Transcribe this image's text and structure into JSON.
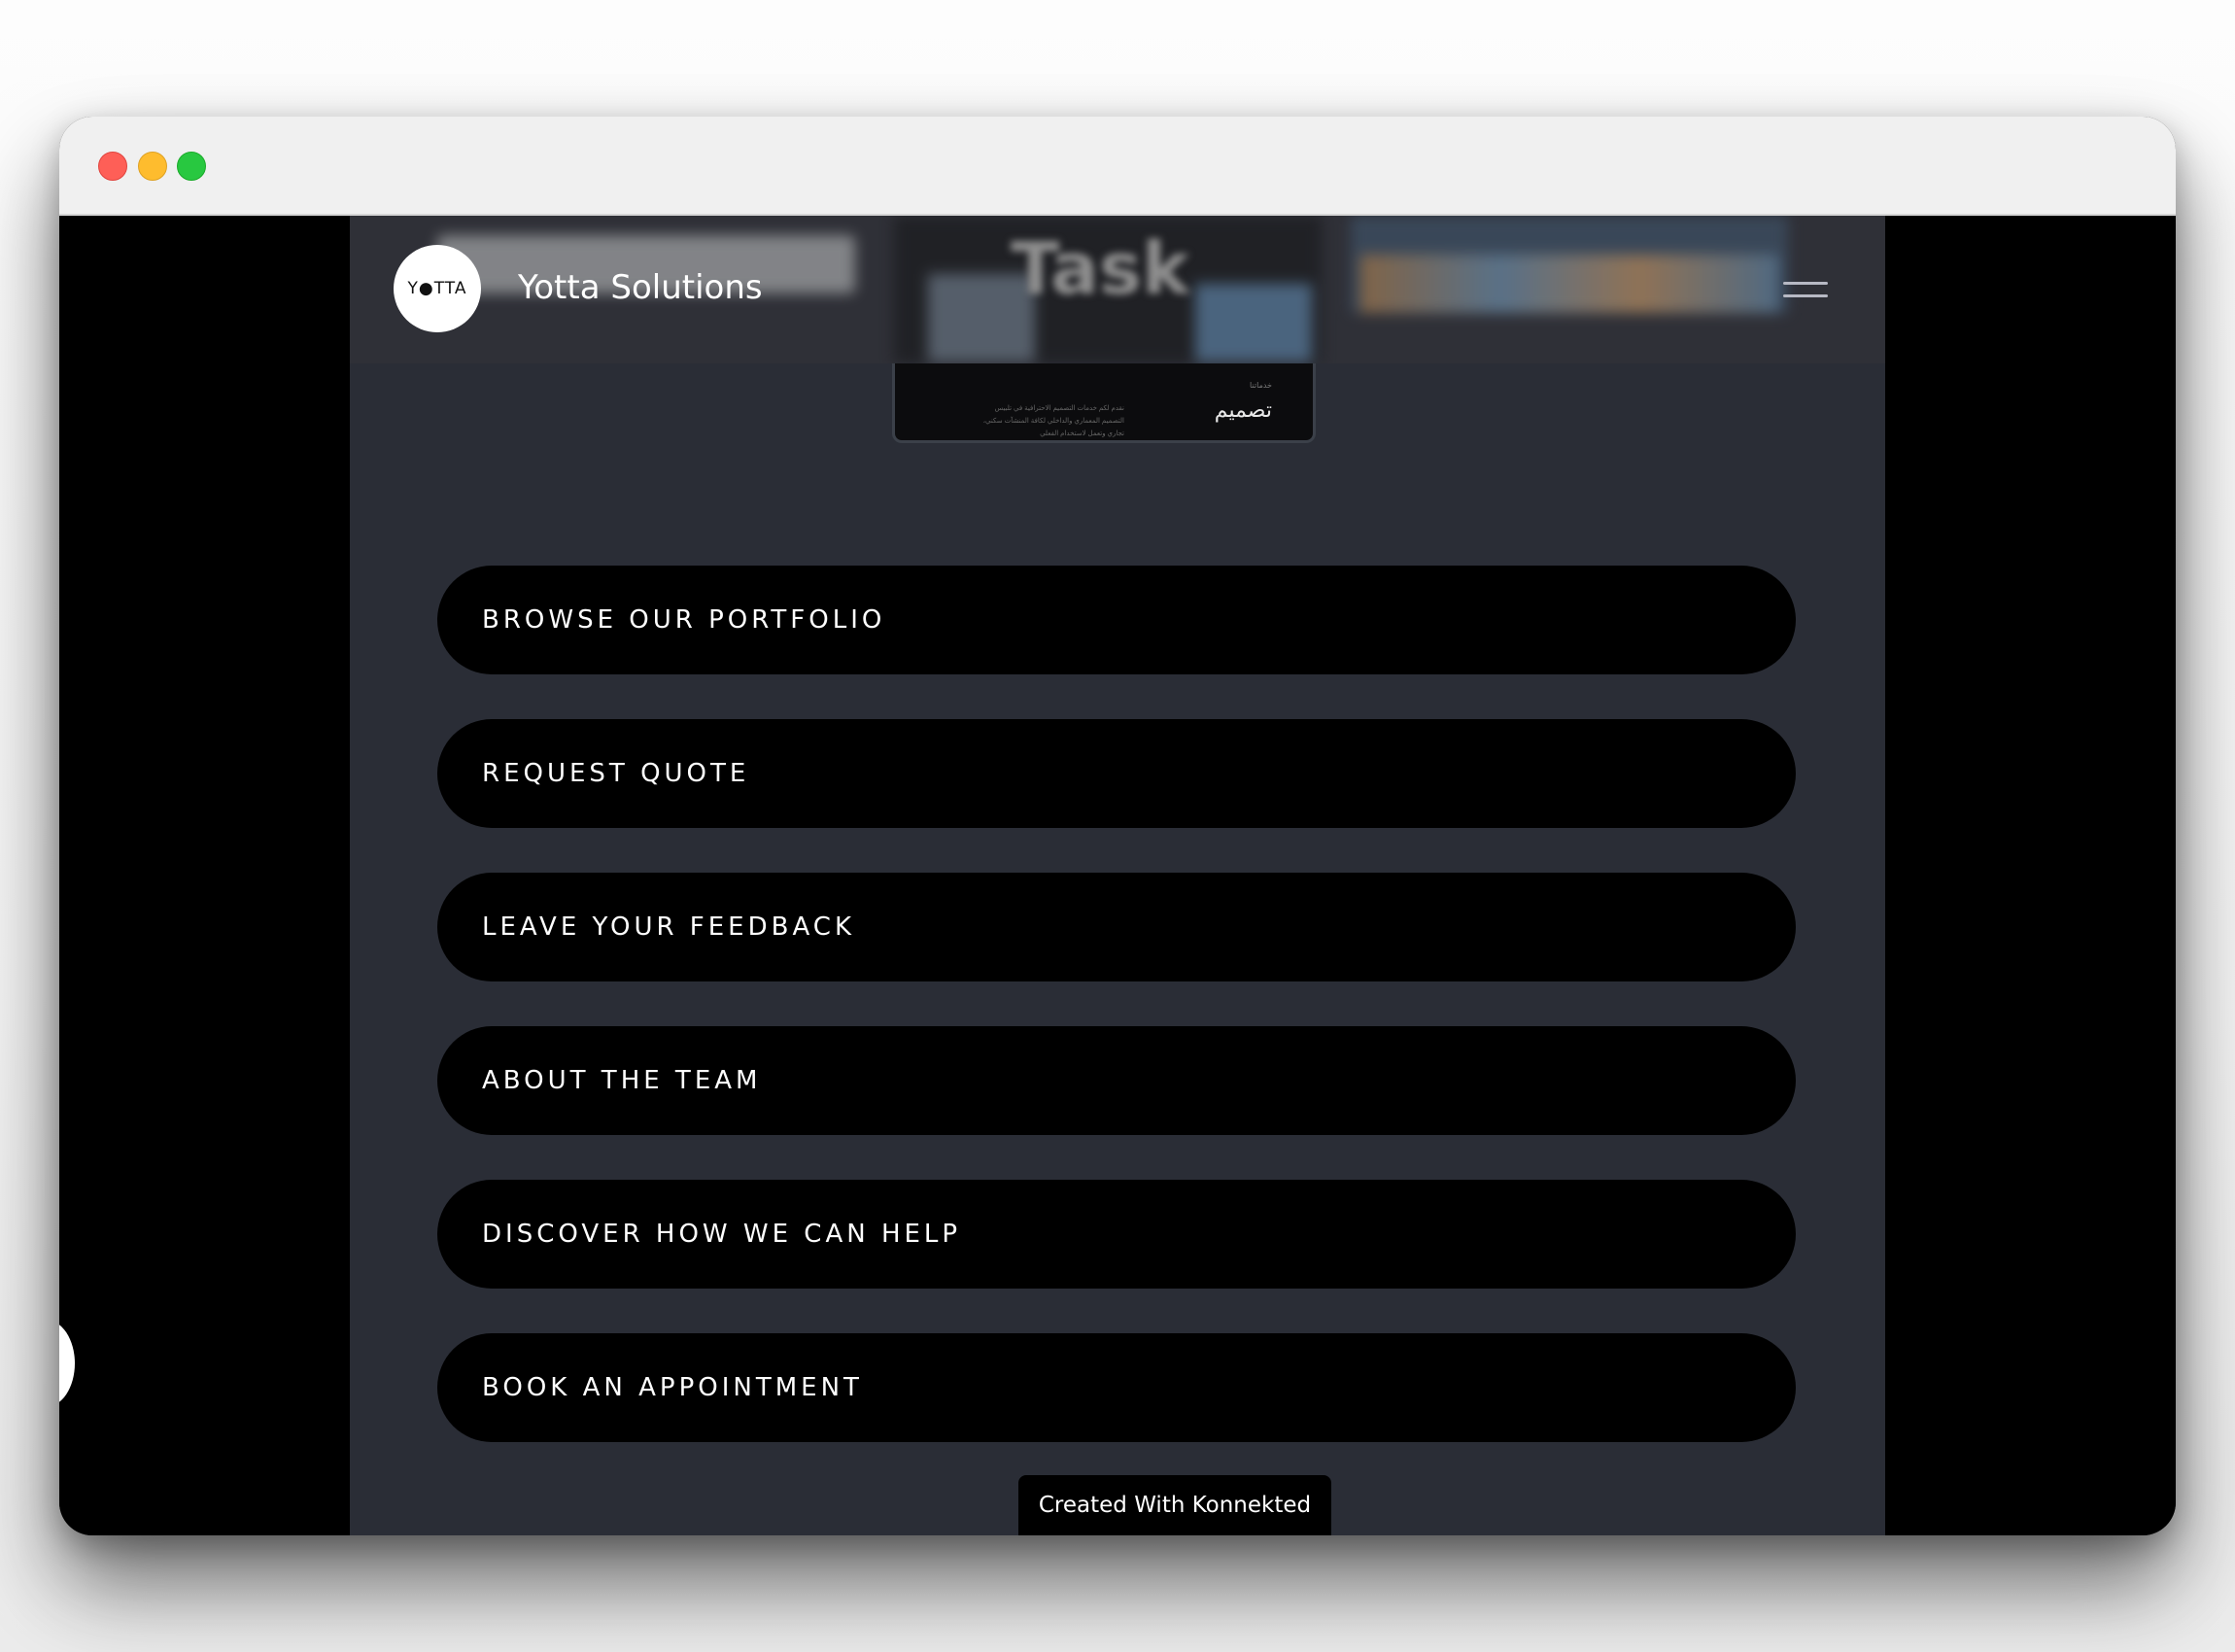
{
  "header": {
    "logo_text": "Y●TTA",
    "brand_name": "Yotta Solutions",
    "background_word": "Task"
  },
  "preview_card": {
    "small_label": "خدماتنا",
    "title": "تصميم",
    "description": "نقدم لكم خدمات التصميم الاحترافية في تلبيس التصميم المعماري والداخلي لكافة المنشآت سكني، تجاري وتعمل لاستخدام الفعلي"
  },
  "links": [
    {
      "label": "BROWSE OUR PORTFOLIO"
    },
    {
      "label": "REQUEST QUOTE"
    },
    {
      "label": "LEAVE YOUR FEEDBACK"
    },
    {
      "label": "ABOUT THE TEAM"
    },
    {
      "label": "DISCOVER HOW WE CAN HELP"
    },
    {
      "label": "BOOK AN APPOINTMENT"
    }
  ],
  "footer": {
    "badge": "Created With Konnekted"
  },
  "colors": {
    "page_bg": "#2a2d36",
    "button_bg": "#000000",
    "button_text": "#ffffff"
  }
}
